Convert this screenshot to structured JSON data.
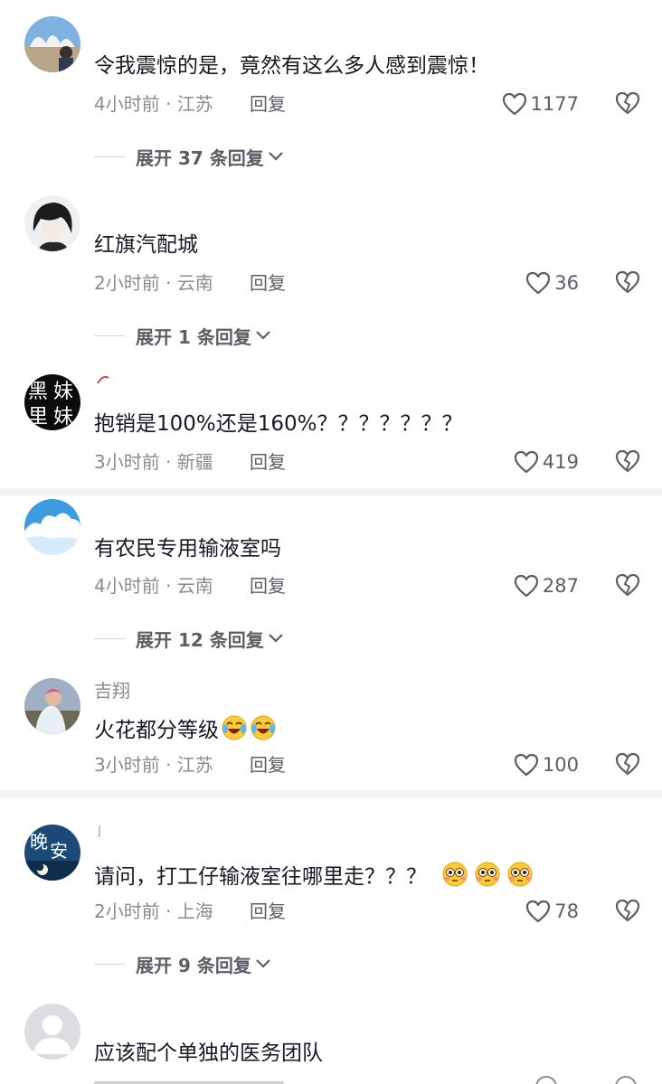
{
  "comments": [
    {
      "text": "令我震惊的是，竟然有这么多人感到震惊！",
      "time_location": "4小时前 · 江苏",
      "reply_label": "回复",
      "likes": "1177",
      "expand_label": "展开 37 条回复"
    },
    {
      "text": "红旗汽配城",
      "time_location": "2小时前 · 云南",
      "reply_label": "回复",
      "likes": "36",
      "expand_label": "展开 1 条回复"
    },
    {
      "text": "抱销是100%还是160%？？？？？？？",
      "time_location": "3小时前 · 新疆",
      "reply_label": "回复",
      "likes": "419"
    },
    {
      "text": "有农民专用输液室吗",
      "time_location": "4小时前 · 云南",
      "reply_label": "回复",
      "likes": "287",
      "expand_label": "展开 12 条回复"
    },
    {
      "username": "吉翔",
      "text": "火花都分等级",
      "time_location": "3小时前 · 江苏",
      "reply_label": "回复",
      "likes": "100"
    },
    {
      "text": "请问，打工仔输液室往哪里走？？？",
      "time_location": "2小时前 · 上海",
      "reply_label": "回复",
      "likes": "78",
      "expand_label": "展开 9 条回复"
    },
    {
      "text": "应该配个单独的医务团队"
    }
  ],
  "avatar_texts": {
    "c3": [
      "黑",
      "妹",
      "里",
      "妹"
    ],
    "c6": [
      "晚",
      "安"
    ]
  },
  "icons": {
    "like": "heart-outline-icon",
    "dislike": "broken-heart-icon",
    "expand": "chevron-down-icon",
    "emoji_laugh": "laugh-cry-emoji",
    "emoji_flushed": "flushed-face-emoji"
  },
  "colors": {
    "text": "#161823",
    "meta": "#8a8b91",
    "action": "#5c5d66",
    "divider": "#f4f4f5"
  }
}
